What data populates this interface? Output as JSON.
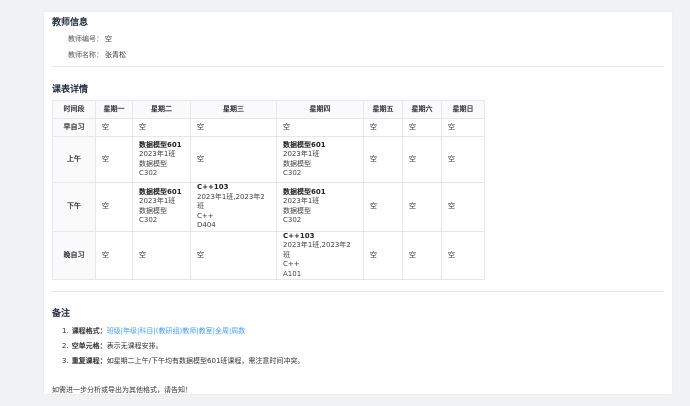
{
  "teacher": {
    "title": "教师信息",
    "id_label": "教师编号：",
    "id_value": "空",
    "name_label": "教师名称：",
    "name_value": "张青松"
  },
  "schedule": {
    "title": "课表详情",
    "headers": [
      "时间段",
      "星期一",
      "星期二",
      "星期三",
      "星期四",
      "星期五",
      "星期六",
      "星期日"
    ],
    "rows": [
      {
        "period": "早自习",
        "cells": [
          {
            "empty": "空"
          },
          {
            "empty": "空"
          },
          {
            "empty": "空"
          },
          {
            "empty": "空"
          },
          {
            "empty": "空"
          },
          {
            "empty": "空"
          },
          {
            "empty": "空"
          }
        ]
      },
      {
        "period": "上午",
        "cells": [
          {
            "empty": "空"
          },
          {
            "name": "数据模型601",
            "lines": [
              "2023年1班",
              "数据模型",
              "C302"
            ]
          },
          {
            "empty": "空"
          },
          {
            "name": "数据模型601",
            "lines": [
              "2023年1班",
              "数据模型",
              "C302"
            ]
          },
          {
            "empty": "空"
          },
          {
            "empty": "空"
          },
          {
            "empty": "空"
          }
        ]
      },
      {
        "period": "下午",
        "cells": [
          {
            "empty": "空"
          },
          {
            "name": "数据模型601",
            "lines": [
              "2023年1班",
              "数据模型",
              "C302"
            ]
          },
          {
            "name": "C++103",
            "lines": [
              "2023年1班,2023年2班",
              "C++",
              "D404"
            ]
          },
          {
            "name": "数据模型601",
            "lines": [
              "2023年1班",
              "数据模型",
              "C302"
            ]
          },
          {
            "empty": "空"
          },
          {
            "empty": "空"
          },
          {
            "empty": "空"
          }
        ]
      },
      {
        "period": "晚自习",
        "cells": [
          {
            "empty": "空"
          },
          {
            "empty": "空"
          },
          {
            "empty": "空"
          },
          {
            "name": "C++103",
            "lines": [
              "2023年1班,2023年2班",
              "C++",
              "A101"
            ]
          },
          {
            "empty": "空"
          },
          {
            "empty": "空"
          },
          {
            "empty": "空"
          }
        ]
      }
    ]
  },
  "notes": {
    "title": "备注",
    "items": [
      {
        "num": "1.",
        "label": "课程格式：",
        "text": "",
        "link": "班级|年级|科目|(教研组)教师|教室|全周|周数"
      },
      {
        "num": "2.",
        "label": "空单元格：",
        "text": "表示无课程安排。",
        "link": ""
      },
      {
        "num": "3.",
        "label": "重复课程：",
        "text": "如星期二上午/下午均有数据模型601班课程，需注意时间冲突。",
        "link": ""
      }
    ],
    "footer": "如需进一步分析或导出为其他格式，请告知！"
  }
}
